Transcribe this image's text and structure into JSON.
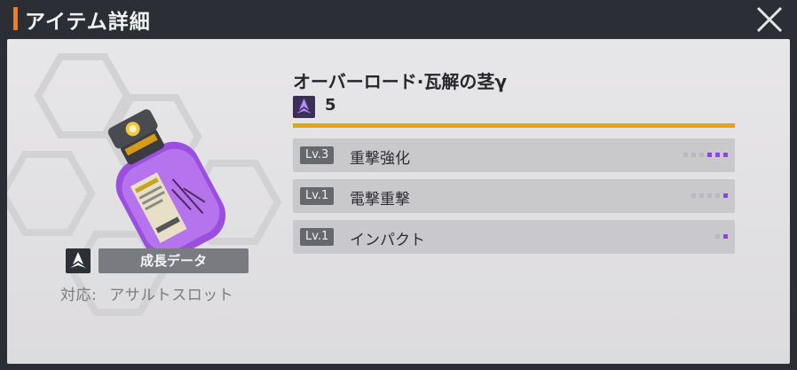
{
  "window": {
    "title": "アイテム詳細"
  },
  "colors": {
    "accent": "#f07d1a",
    "rarity": "#e8a410",
    "level_active": "#8e45d8"
  },
  "icons": {
    "close": "close-icon",
    "source": "crest-icon",
    "rarity": "crest-icon"
  },
  "item": {
    "name": "オーバーロード·瓦解の茎γ",
    "rarity_value": "5",
    "source_label": "成長データ",
    "compat_label": "対応:",
    "compat_value": "アサルトスロット"
  },
  "effects": [
    {
      "level": "Lv.3",
      "name": "重撃強化",
      "level_num": 3,
      "max_level": 6
    },
    {
      "level": "Lv.1",
      "name": "電撃重撃",
      "level_num": 1,
      "max_level": 5
    },
    {
      "level": "Lv.1",
      "name": "インパクト",
      "level_num": 1,
      "max_level": 2
    }
  ]
}
